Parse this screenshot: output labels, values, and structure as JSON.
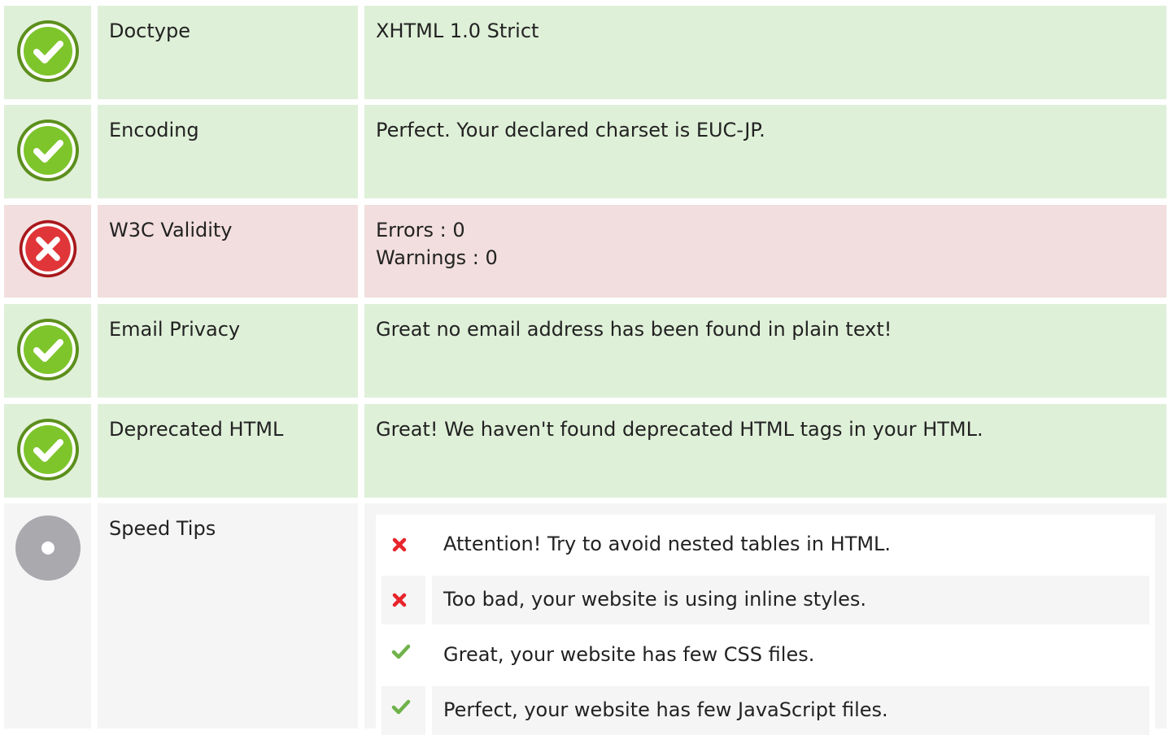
{
  "colors": {
    "pass_bg": "#dff0d8",
    "fail_bg": "#f2dede",
    "info_bg": "#f5f5f5",
    "pass_icon": "#7ec52c",
    "fail_icon": "#e0363a",
    "info_icon": "#a9a9ae",
    "tip_fail": "#e8242b",
    "tip_pass": "#6fb24a"
  },
  "rows": [
    {
      "status": "pass",
      "icon": "check-circle-icon",
      "label": "Doctype",
      "lines": [
        "XHTML 1.0 Strict"
      ]
    },
    {
      "status": "pass",
      "icon": "check-circle-icon",
      "label": "Encoding",
      "lines": [
        "Perfect. Your declared charset is EUC-JP."
      ]
    },
    {
      "status": "fail",
      "icon": "cross-circle-icon",
      "label": "W3C Validity",
      "lines": [
        "Errors : 0",
        "Warnings : 0"
      ]
    },
    {
      "status": "pass",
      "icon": "check-circle-icon",
      "label": "Email Privacy",
      "lines": [
        "Great no email address has been found in plain text!"
      ]
    },
    {
      "status": "pass",
      "icon": "check-circle-icon",
      "label": "Deprecated HTML",
      "lines": [
        "Great! We haven't found deprecated HTML tags in your HTML."
      ]
    }
  ],
  "speed": {
    "icon": "info-circle-icon",
    "label": "Speed Tips",
    "tips": [
      {
        "status": "fail",
        "icon": "cross-icon",
        "text": "Attention! Try to avoid nested tables in HTML."
      },
      {
        "status": "fail",
        "icon": "cross-icon",
        "text": "Too bad, your website is using inline styles."
      },
      {
        "status": "pass",
        "icon": "check-icon",
        "text": "Great, your website has few CSS files."
      },
      {
        "status": "pass",
        "icon": "check-icon",
        "text": "Perfect, your website has few JavaScript files."
      }
    ]
  }
}
